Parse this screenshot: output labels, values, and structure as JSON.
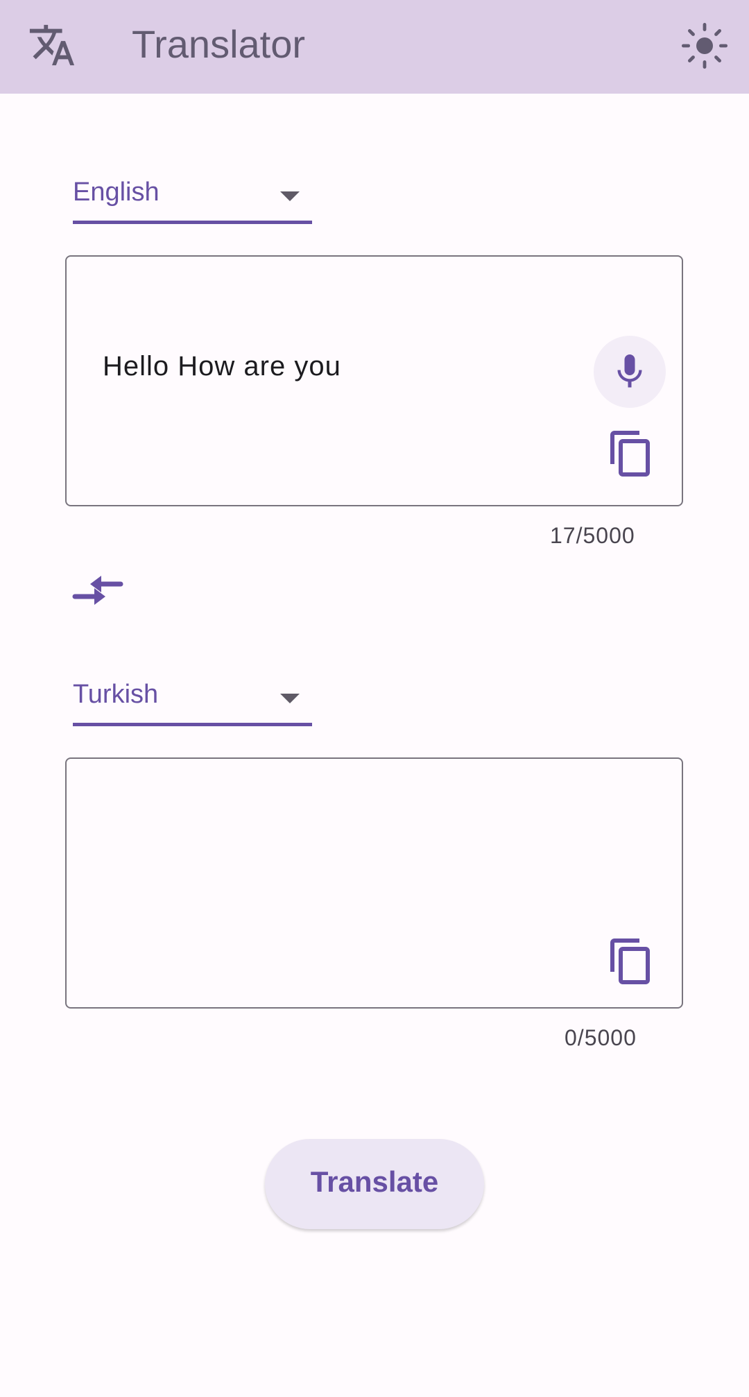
{
  "app_bar": {
    "title": "Translator",
    "leading_icon": "translate-icon",
    "action_icon": "light-mode-icon"
  },
  "source": {
    "language": "English",
    "text": "Hello How are you",
    "counter": "17/5000",
    "mic_icon": "mic-icon",
    "copy_icon": "copy-icon"
  },
  "swap_icon": "swap-languages-icon",
  "target": {
    "language": "Turkish",
    "text": "",
    "counter": "0/5000",
    "copy_icon": "copy-icon"
  },
  "translate_button": {
    "label": "Translate"
  },
  "colors": {
    "app_bar_bg": "#dccde6",
    "primary": "#6750a4",
    "background": "#fffbfe",
    "outline": "#79747e",
    "button_bg": "#ece6f4"
  }
}
